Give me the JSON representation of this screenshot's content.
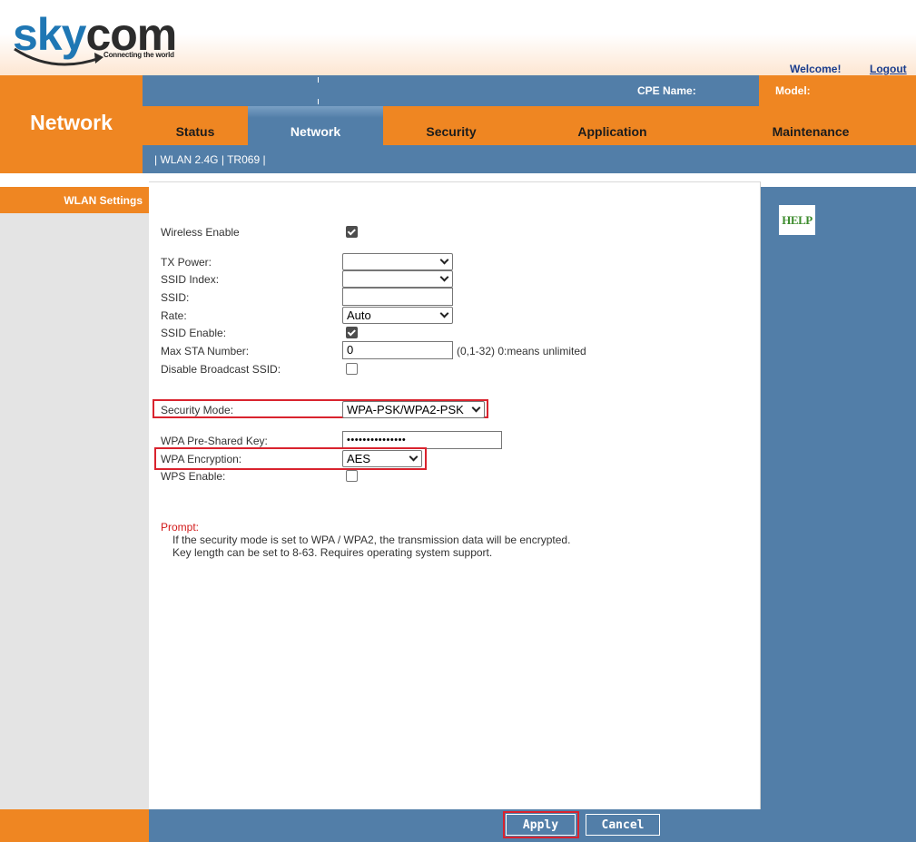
{
  "header": {
    "logo": {
      "sky": "sky",
      "com": "com",
      "tagline": "Connecting the world"
    },
    "welcome": "Welcome!",
    "logout": "Logout"
  },
  "section_title": "Network",
  "info_bar": {
    "cpe_name_label": "CPE Name:",
    "model_label": "Model:"
  },
  "tabs": [
    {
      "label": "Status",
      "active": false
    },
    {
      "label": "Network",
      "active": true
    },
    {
      "label": "Security",
      "active": false
    },
    {
      "label": "Application",
      "active": false
    },
    {
      "label": "Maintenance",
      "active": false
    }
  ],
  "subnav": {
    "items": [
      "WLAN 2.4G",
      "TR069"
    ],
    "separator": "|"
  },
  "sidebar": {
    "items": [
      {
        "label": "WLAN Settings",
        "active": true
      }
    ]
  },
  "help": {
    "label": "HELP"
  },
  "form": {
    "wireless_enable": {
      "label": "Wireless Enable",
      "checked": true
    },
    "tx_power": {
      "label": "TX Power:",
      "value": ""
    },
    "ssid_index": {
      "label": "SSID Index:",
      "value": ""
    },
    "ssid": {
      "label": "SSID:",
      "value": ""
    },
    "rate": {
      "label": "Rate:",
      "value": "Auto"
    },
    "ssid_enable": {
      "label": "SSID Enable:",
      "checked": true
    },
    "max_sta": {
      "label": "Max STA Number:",
      "value": "0",
      "hint": "(0,1-32) 0:means unlimited"
    },
    "disable_broadcast": {
      "label": "Disable Broadcast SSID:",
      "checked": false
    },
    "security_mode": {
      "label": "Security Mode:",
      "value": "WPA-PSK/WPA2-PSK"
    },
    "wpa_key": {
      "label": "WPA Pre-Shared Key:",
      "value": "•••••••••••••••"
    },
    "wpa_encryption": {
      "label": "WPA Encryption:",
      "value": "AES"
    },
    "wps_enable": {
      "label": "WPS Enable:",
      "checked": false
    }
  },
  "prompt": {
    "title": "Prompt:",
    "lines": [
      "If the security mode is set to WPA / WPA2, the transmission data will be encrypted.",
      "Key length can be set to 8-63. Requires operating system support."
    ]
  },
  "footer": {
    "apply_label": "Apply",
    "cancel_label": "Cancel"
  },
  "colors": {
    "orange": "#ef8622",
    "blue": "#527ea8",
    "highlight_red": "#d9232e",
    "prompt_red": "#d21a1a"
  }
}
